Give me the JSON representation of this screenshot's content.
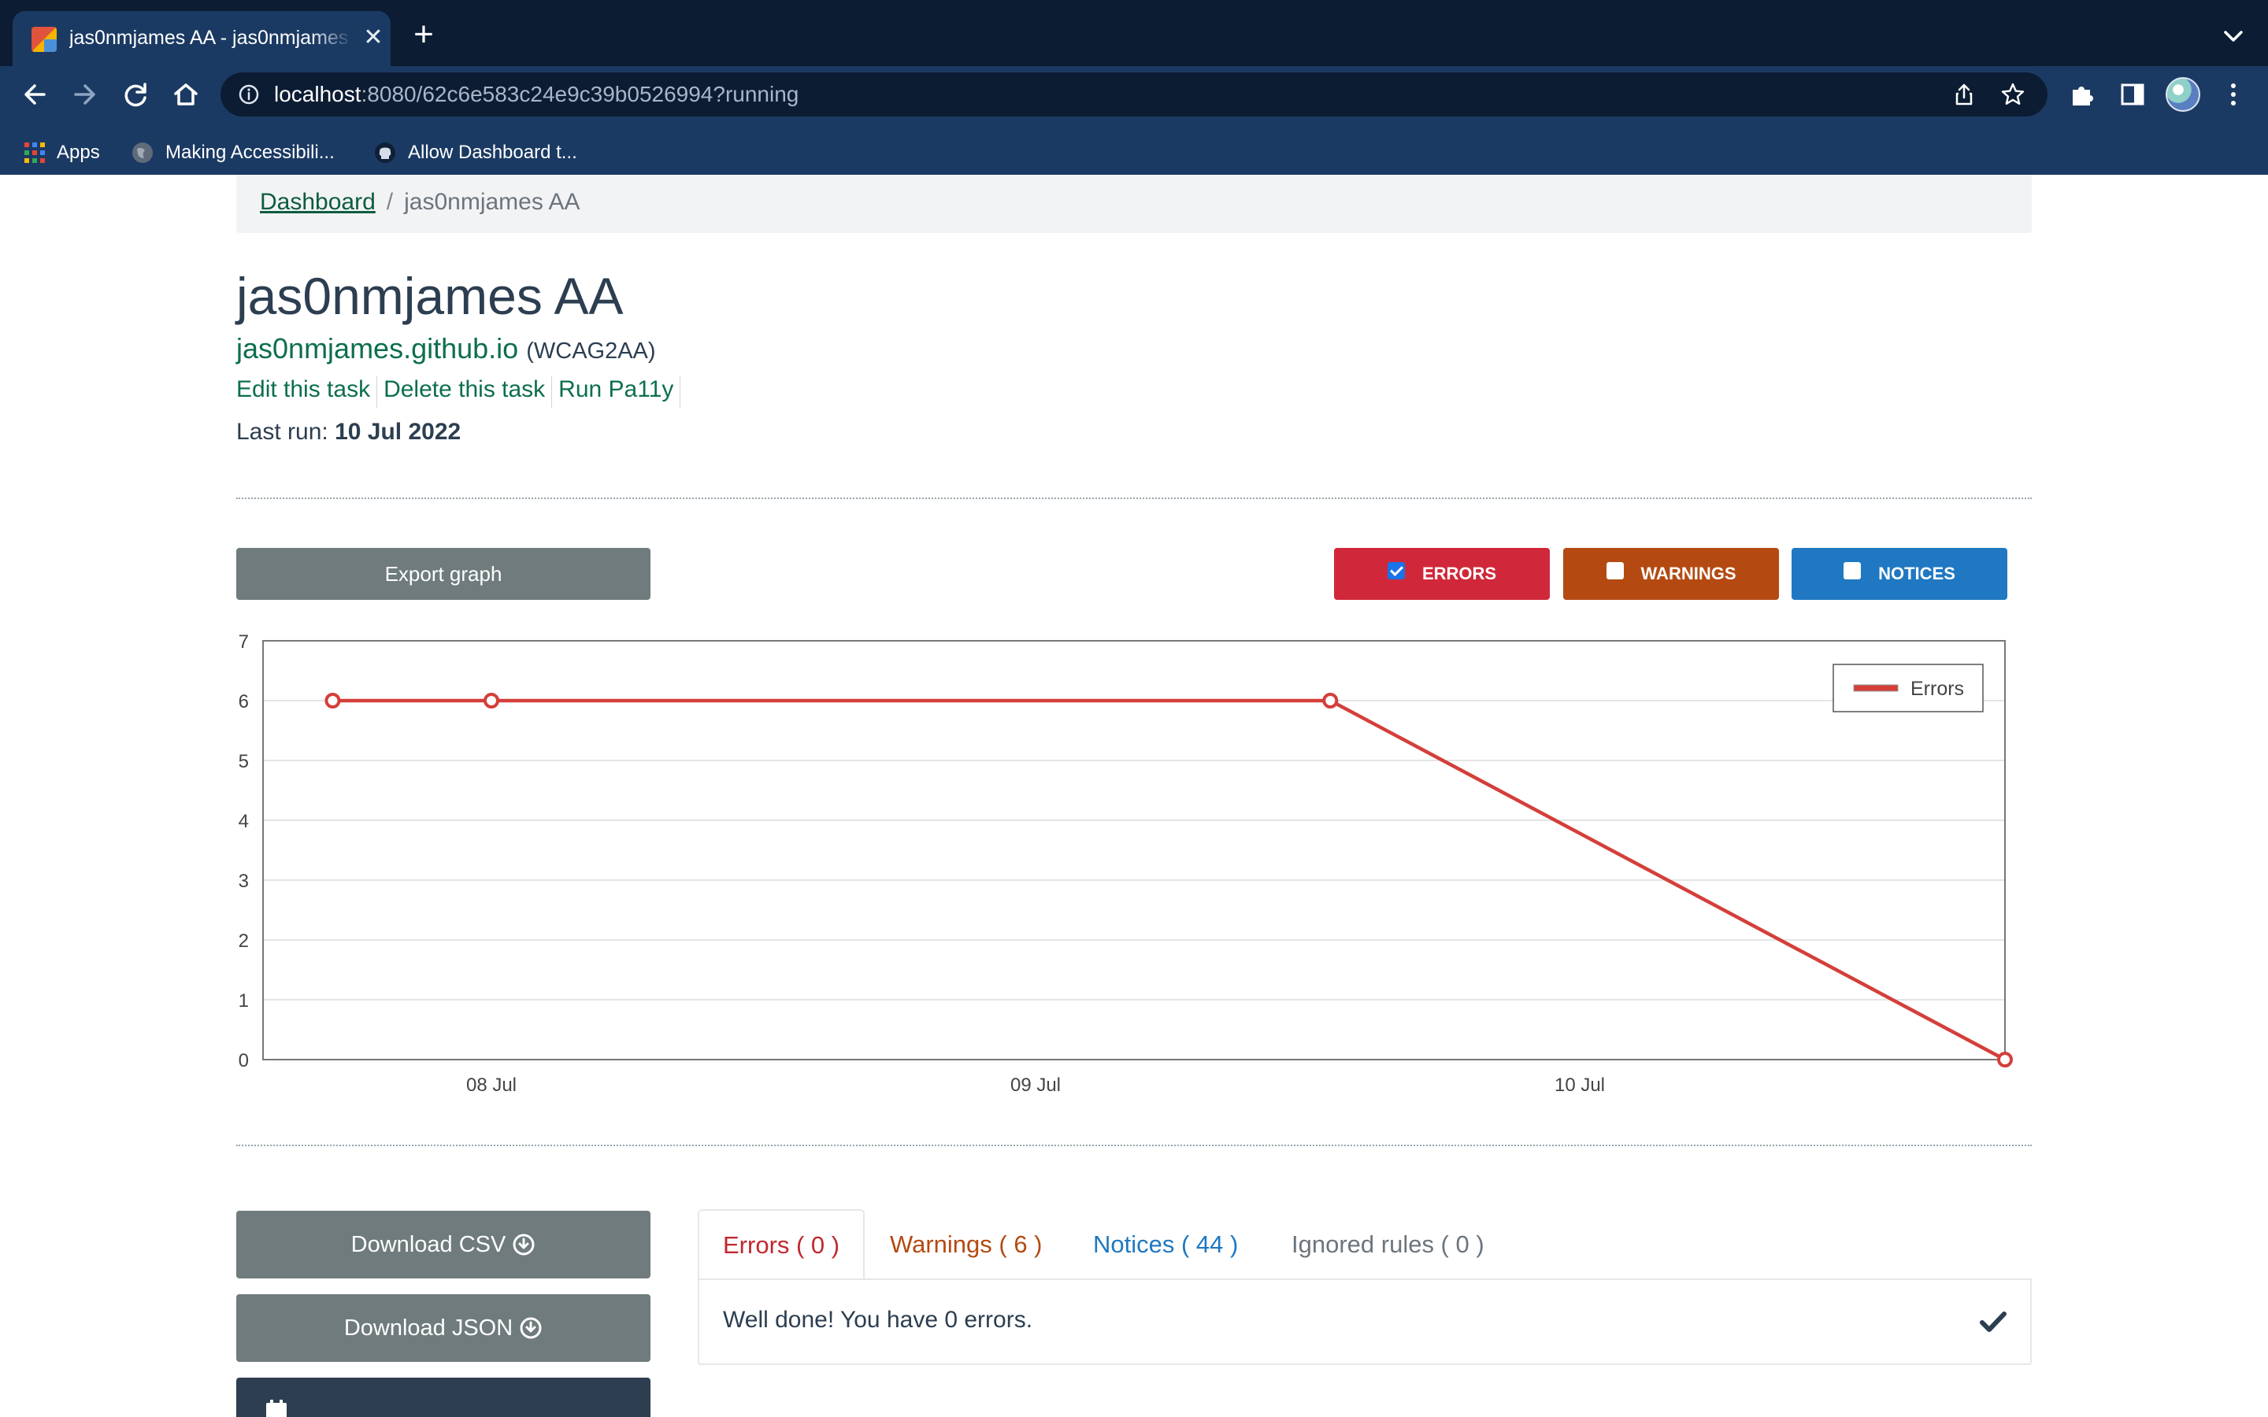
{
  "browser": {
    "tab_title": "jas0nmjames AA - jas0nmjames AA",
    "url_host": "localhost",
    "url_rest": ":8080/62c6e583c24e9c39b0526994?running",
    "bookmarks": [
      {
        "label": "Apps"
      },
      {
        "label": "Making Accessibili..."
      },
      {
        "label": "Allow Dashboard t..."
      }
    ]
  },
  "breadcrumb": {
    "root": "Dashboard",
    "separator": "/",
    "current": "jas0nmjames AA"
  },
  "task": {
    "title": "jas0nmjames AA",
    "url": "jas0nmjames.github.io",
    "standard": "(WCAG2AA)",
    "actions": [
      "Edit this task",
      "Delete this task",
      "Run Pa11y"
    ],
    "last_run_label": "Last run:",
    "last_run_value": "10 Jul 2022"
  },
  "graph_controls": {
    "export_label": "Export graph",
    "errors_label": "ERRORS",
    "errors_checked": true,
    "warnings_label": "WARNINGS",
    "warnings_checked": false,
    "notices_label": "NOTICES",
    "notices_checked": false,
    "colors": {
      "errors": "#d0283a",
      "warnings": "#b44a12",
      "notices": "#1f78c1"
    }
  },
  "chart_data": {
    "type": "line",
    "x": [
      "2022-07-07",
      "2022-07-08",
      "2022-07-09",
      "2022-07-10"
    ],
    "x_ticks": [
      "08 Jul",
      "09 Jul",
      "10 Jul"
    ],
    "y_ticks": [
      "0",
      "1",
      "2",
      "3",
      "4",
      "5",
      "6",
      "7"
    ],
    "series": [
      {
        "name": "Errors",
        "color": "#d43f3a",
        "points": [
          {
            "x": "2022-07-07 17:00",
            "y": 6
          },
          {
            "x": "2022-07-08 00:00",
            "y": 6
          },
          {
            "x": "2022-07-09 13:00",
            "y": 6
          },
          {
            "x": "2022-07-10 22:00",
            "y": 0
          }
        ]
      }
    ],
    "ylim": [
      0,
      7
    ],
    "grid": true,
    "legend": "top-right"
  },
  "downloads": {
    "csv_label": "Download CSV",
    "json_label": "Download JSON"
  },
  "results": {
    "tabs": [
      {
        "label": "Errors ( 0 )",
        "color": "#c0282f"
      },
      {
        "label": "Warnings ( 6 )",
        "color": "#b44a12"
      },
      {
        "label": "Notices ( 44 )",
        "color": "#1f78c1"
      },
      {
        "label": "Ignored rules ( 0 )",
        "color": "#6c757d"
      }
    ],
    "message": "Well done! You have 0 errors."
  }
}
